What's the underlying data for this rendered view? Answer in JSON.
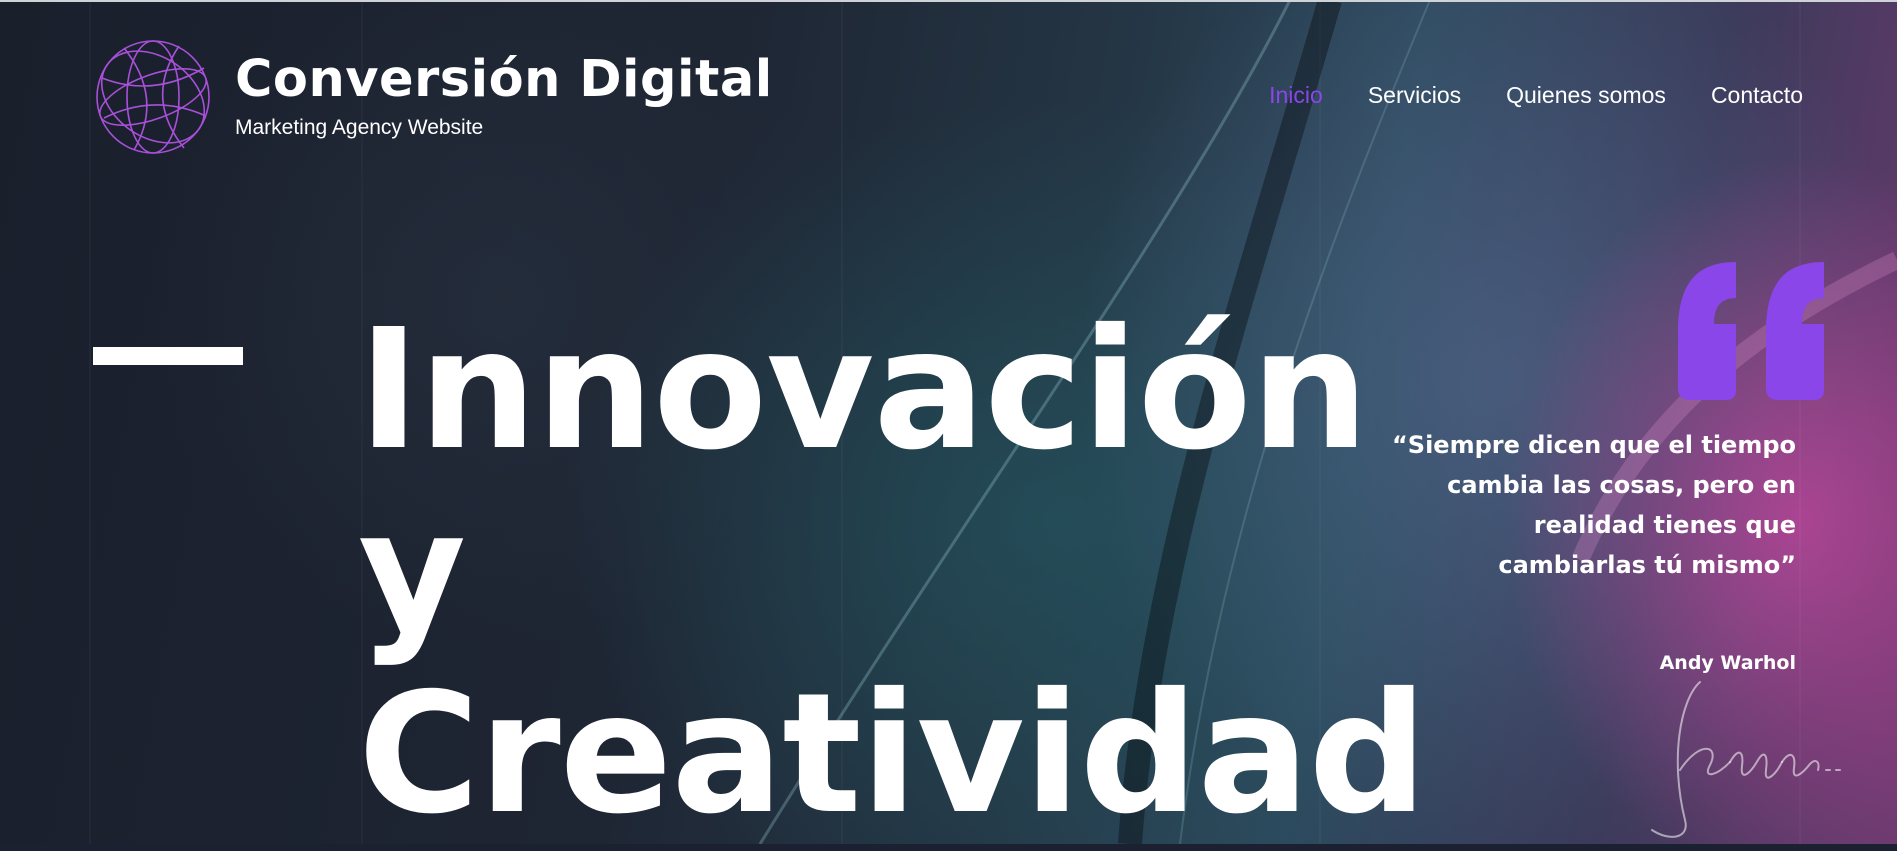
{
  "brand": {
    "title": "Conversión Digital",
    "subtitle": "Marketing Agency Website",
    "logo_icon": "wireframe-globe-icon"
  },
  "nav": {
    "items": [
      {
        "label": "Inicio",
        "active": true
      },
      {
        "label": "Servicios",
        "active": false
      },
      {
        "label": "Quienes somos",
        "active": false
      },
      {
        "label": "Contacto",
        "active": false
      }
    ]
  },
  "hero": {
    "lines": [
      "Innovación",
      "y",
      "Creatividad"
    ]
  },
  "quote": {
    "icon": "quote-mark-icon",
    "text": "“Siempre dicen que el tiempo cambia las cosas, pero en realidad tienes que cambiarlas tú mismo”",
    "author": "Andy Warhol",
    "signature": "Andy Warhol"
  },
  "colors": {
    "accent": "#8a46e8",
    "text": "#ffffff",
    "background_dark": "#1b2130"
  }
}
